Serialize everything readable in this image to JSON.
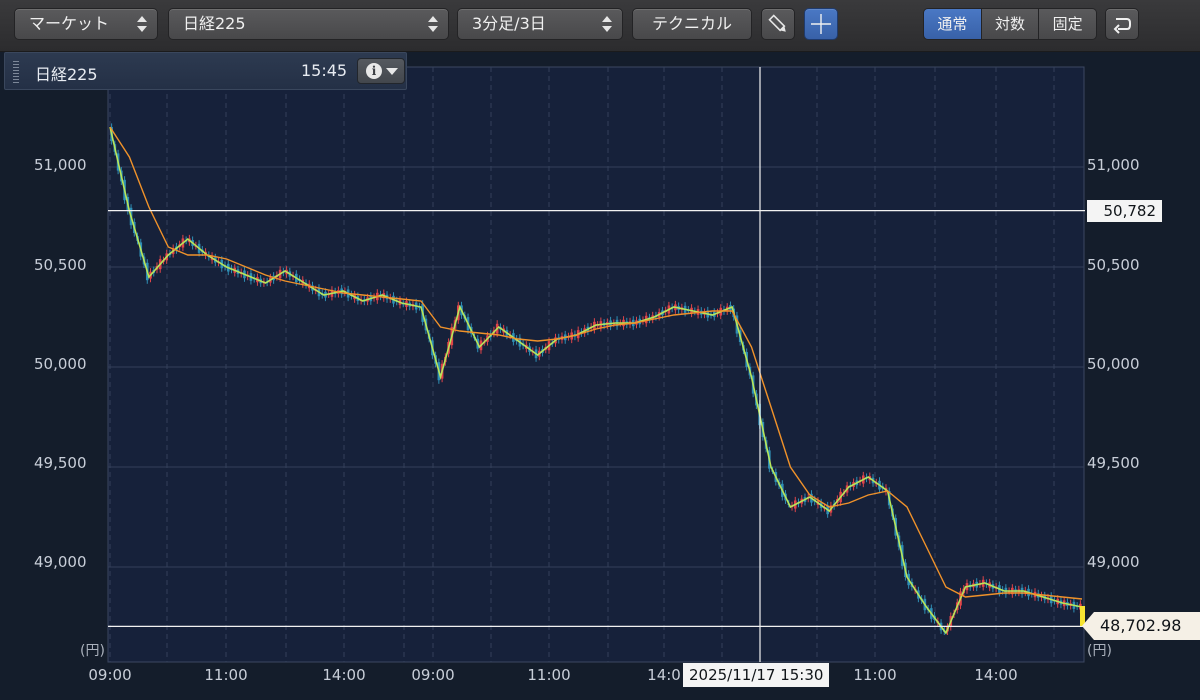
{
  "toolbar": {
    "market_label": "マーケット",
    "symbol_label": "日経225",
    "period_label": "3分足/3日",
    "technical_label": "テクニカル",
    "scale_modes": [
      "通常",
      "対数",
      "固定"
    ],
    "active_scale_mode": "通常",
    "active_color": "#3f6cb8"
  },
  "info_header": {
    "title": "日経225",
    "time": "15:45"
  },
  "axis": {
    "y_ticks": [
      "51,000",
      "50,500",
      "50,000",
      "49,500",
      "49,000"
    ],
    "x_ticks": [
      "09:00",
      "11:00",
      "14:00",
      "09:00",
      "11:00",
      "14:0",
      "11:00",
      "14:00"
    ],
    "unit": "(円)"
  },
  "crosshair": {
    "price": "50,782",
    "time": "2025/11/17 15:30"
  },
  "last_price": "48,702.98",
  "colors": {
    "background": "#141d2b",
    "grid": "#34405a",
    "up_candle": "#e0454a",
    "down_candle": "#2f8fb5",
    "fast_ma": "#b8e65a",
    "slow_ma": "#f0922a",
    "last_marker": "#f5e332"
  },
  "chart_data": {
    "type": "line",
    "title": "",
    "xlabel": "",
    "ylabel": "(円)",
    "ylim": [
      48670,
      51500
    ],
    "x_labels": [
      "09:00",
      "11:00",
      "14:00",
      "09:00",
      "11:00",
      "14:0",
      "11:00",
      "14:00"
    ],
    "last_value": 48702.98,
    "crosshair_value": 50782,
    "series": [
      {
        "name": "",
        "values": [
          51200,
          50780,
          50450,
          50560,
          50640,
          50560,
          50500,
          50460,
          50420,
          50480,
          50420,
          50360,
          50380,
          50330,
          50360,
          50320,
          50300,
          49950,
          50300,
          50100,
          50200,
          50130,
          50060,
          50140,
          50160,
          50210,
          50220,
          50220,
          50250,
          50300,
          50280,
          50260,
          50300,
          49950,
          49500,
          49300,
          49350,
          49280,
          49400,
          49450,
          49380,
          48950,
          48800,
          48670,
          48900,
          48920,
          48880,
          48880,
          48850,
          48820,
          48800
        ]
      },
      {
        "name": "",
        "values": [
          51200,
          51050,
          50800,
          50600,
          50560,
          50560,
          50540,
          50500,
          50460,
          50430,
          50410,
          50390,
          50370,
          50360,
          50350,
          50340,
          50330,
          50200,
          50180,
          50170,
          50160,
          50140,
          50130,
          50140,
          50160,
          50190,
          50210,
          50220,
          50240,
          50260,
          50270,
          50280,
          50280,
          50100,
          49800,
          49500,
          49360,
          49300,
          49320,
          49360,
          49380,
          49300,
          49100,
          48900,
          48850,
          48860,
          48870,
          48870,
          48860,
          48850,
          48840
        ]
      }
    ]
  }
}
